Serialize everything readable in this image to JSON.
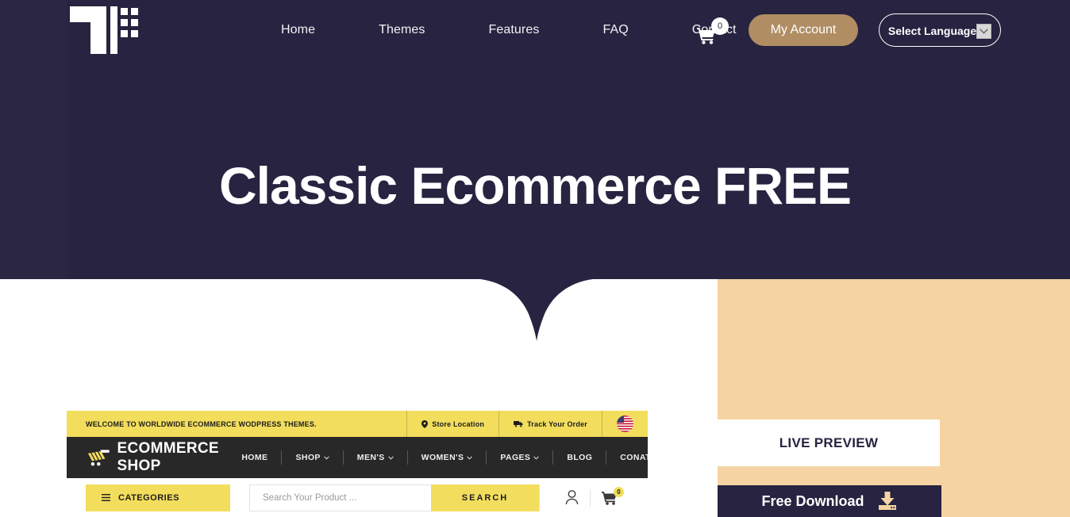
{
  "header": {
    "logo_icon": "pixel-t-logo-icon",
    "nav": [
      {
        "label": "Home"
      },
      {
        "label": "Themes"
      },
      {
        "label": "Features"
      },
      {
        "label": "FAQ"
      },
      {
        "label": "Contact"
      }
    ],
    "cart": {
      "icon": "shopping-cart-icon",
      "count": "0"
    },
    "account_label": "My Account",
    "language": {
      "label": "Select Language",
      "caret_icon": "chevron-down-icon"
    }
  },
  "hero": {
    "title": "Classic Ecommerce FREE"
  },
  "preview": {
    "topbar": {
      "welcome": "WELCOME TO WORLDWIDE ECOMMERCE WODPRESS THEMES.",
      "store_location": "Store Location",
      "store_location_icon": "map-pin-icon",
      "track_order": "Track Your Order",
      "track_order_icon": "truck-icon",
      "flag_icon": "us-flag-icon"
    },
    "brand": {
      "name": "ECOMMERCE SHOP",
      "icon": "shopping-cart-logo-icon"
    },
    "menu": [
      {
        "label": "HOME",
        "caret": false
      },
      {
        "label": "SHOP",
        "caret": true
      },
      {
        "label": "MEN'S",
        "caret": true
      },
      {
        "label": "WOMEN'S",
        "caret": true
      },
      {
        "label": "PAGES",
        "caret": true
      },
      {
        "label": "BLOG",
        "caret": false
      },
      {
        "label": "CONATCT US",
        "caret": false
      }
    ],
    "search": {
      "categories_label": "CATEGORIES",
      "categories_icon": "hamburger-icon",
      "placeholder": "Search Your Product ...",
      "button_label": "SEARCH",
      "user_icon": "user-icon",
      "cart_icon": "shopping-cart-icon",
      "cart_count": "0"
    }
  },
  "actions": {
    "live_preview_label": "LIVE PREVIEW",
    "free_download_label": "Free Download",
    "download_icon": "download-icon"
  },
  "colors": {
    "navy": "#272340",
    "tan": "#b08d63",
    "peach": "#f5d3a3",
    "yellow": "#f2dd5d",
    "dark": "#282828",
    "white": "#ffffff"
  }
}
